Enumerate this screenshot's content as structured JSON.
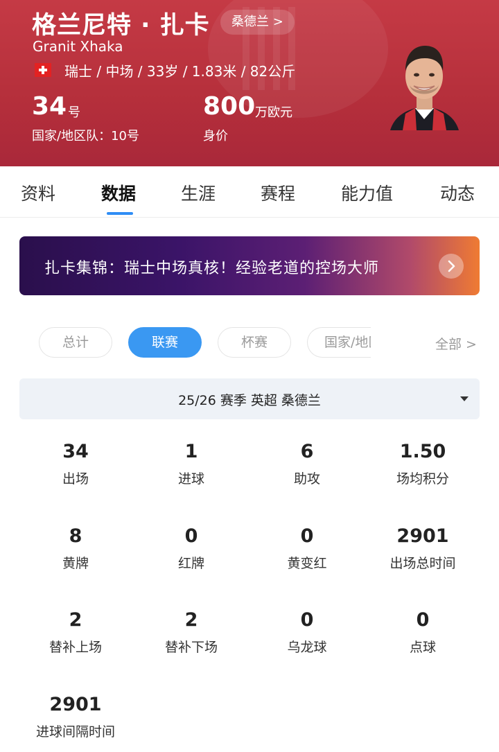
{
  "header": {
    "name_cn": "格兰尼特 · 扎卡",
    "club_link": "桑德兰 >",
    "name_en": "Granit Xhaka",
    "bio": "瑞士 / 中场 / 33岁 / 1.83米 / 82公斤",
    "shirt_number": "34",
    "shirt_number_unit": "号",
    "national_team": "国家/地区队：10号",
    "market_value": "800",
    "market_value_unit": "万欧元",
    "market_value_label": "身价",
    "colors": {
      "primary": "#c53a45",
      "flag": "#e32222"
    }
  },
  "tabs": [
    {
      "label": "资料"
    },
    {
      "label": "数据",
      "active": true
    },
    {
      "label": "生涯"
    },
    {
      "label": "赛程"
    },
    {
      "label": "能力值"
    },
    {
      "label": "动态"
    }
  ],
  "banner": {
    "text": "扎卡集锦：瑞士中场真核！经验老道的控场大师",
    "icon": "chevron-right-icon"
  },
  "filters": {
    "chips": [
      "总计",
      "联赛",
      "杯赛",
      "国家/地区队"
    ],
    "active": "联赛",
    "all_label": "全部 >",
    "accent": "#3a98f2"
  },
  "season": {
    "label": "25/26 赛季  英超  桑德兰",
    "icon": "caret-down-icon"
  },
  "stats": [
    {
      "value": "34",
      "label": "出场"
    },
    {
      "value": "1",
      "label": "进球"
    },
    {
      "value": "6",
      "label": "助攻"
    },
    {
      "value": "1.50",
      "label": "场均积分"
    },
    {
      "value": "8",
      "label": "黄牌"
    },
    {
      "value": "0",
      "label": "红牌"
    },
    {
      "value": "0",
      "label": "黄变红"
    },
    {
      "value": "2901",
      "label": "出场总时间"
    },
    {
      "value": "2",
      "label": "替补上场"
    },
    {
      "value": "2",
      "label": "替补下场"
    },
    {
      "value": "0",
      "label": "乌龙球"
    },
    {
      "value": "0",
      "label": "点球"
    },
    {
      "value": "2901",
      "label": "进球间隔时间"
    }
  ]
}
